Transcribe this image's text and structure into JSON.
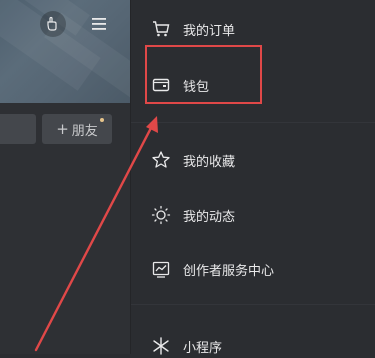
{
  "colors": {
    "accent_red": "#e04848",
    "drawer_bg": "#2b2d31",
    "text": "#e9e9ea"
  },
  "left_panel": {
    "friend_button": {
      "plus": "+",
      "label": "朋友"
    }
  },
  "drawer": {
    "items": [
      {
        "label": "我的订单",
        "icon": "cart-icon"
      },
      {
        "label": "钱包",
        "icon": "wallet-icon"
      },
      {
        "label": "我的收藏",
        "icon": "star-icon"
      },
      {
        "label": "我的动态",
        "icon": "sun-icon"
      },
      {
        "label": "创作者服务中心",
        "icon": "chart-icon"
      },
      {
        "label": "小程序",
        "icon": "mini-program-icon"
      }
    ]
  }
}
